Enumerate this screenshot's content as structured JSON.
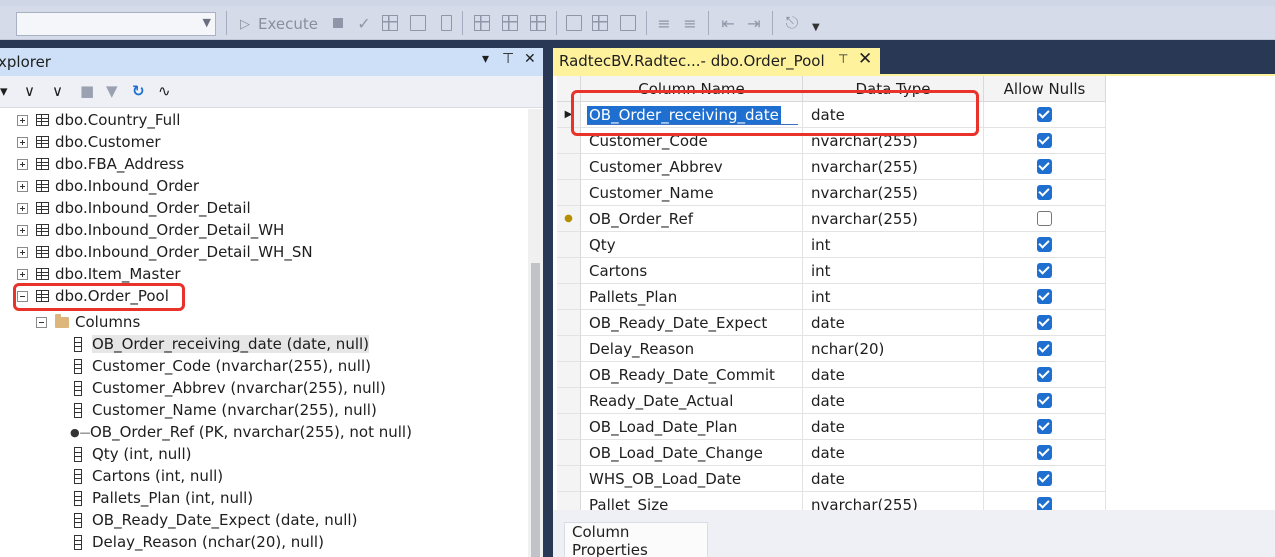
{
  "toolbar": {
    "execute_label": "Execute",
    "database_value": ""
  },
  "object_explorer": {
    "title": "xplorer",
    "tree": [
      {
        "label": "dbo.Country_Full",
        "kind": "table",
        "expanded": false
      },
      {
        "label": "dbo.Customer",
        "kind": "table",
        "expanded": false
      },
      {
        "label": "dbo.FBA_Address",
        "kind": "table",
        "expanded": false
      },
      {
        "label": "dbo.Inbound_Order",
        "kind": "table",
        "expanded": false
      },
      {
        "label": "dbo.Inbound_Order_Detail",
        "kind": "table",
        "expanded": false
      },
      {
        "label": "dbo.Inbound_Order_Detail_WH",
        "kind": "table",
        "expanded": false
      },
      {
        "label": "dbo.Inbound_Order_Detail_WH_SN",
        "kind": "table",
        "expanded": false
      },
      {
        "label": "dbo.Item_Master",
        "kind": "table",
        "expanded": false
      },
      {
        "label": "dbo.Order_Pool",
        "kind": "table",
        "expanded": true
      }
    ],
    "folder": "Columns",
    "columns": [
      {
        "label": "OB_Order_receiving_date (date, null)",
        "pk": false,
        "selected": true
      },
      {
        "label": "Customer_Code (nvarchar(255), null)",
        "pk": false
      },
      {
        "label": "Customer_Abbrev (nvarchar(255), null)",
        "pk": false
      },
      {
        "label": "Customer_Name (nvarchar(255), null)",
        "pk": false
      },
      {
        "label": "OB_Order_Ref (PK, nvarchar(255), not null)",
        "pk": true
      },
      {
        "label": "Qty (int, null)",
        "pk": false
      },
      {
        "label": "Cartons (int, null)",
        "pk": false
      },
      {
        "label": "Pallets_Plan (int, null)",
        "pk": false
      },
      {
        "label": "OB_Ready_Date_Expect (date, null)",
        "pk": false
      },
      {
        "label": "Delay_Reason (nchar(20), null)",
        "pk": false
      }
    ]
  },
  "designer": {
    "tab_title": "RadtecBV.Radtec...- dbo.Order_Pool",
    "headers": {
      "name": "Column Name",
      "type": "Data Type",
      "nulls": "Allow Nulls"
    },
    "rows": [
      {
        "name": "OB_Order_receiving_date",
        "type": "date",
        "nulls": true,
        "editing": true
      },
      {
        "name": "Customer_Code",
        "type": "nvarchar(255)",
        "nulls": true
      },
      {
        "name": "Customer_Abbrev",
        "type": "nvarchar(255)",
        "nulls": true
      },
      {
        "name": "Customer_Name",
        "type": "nvarchar(255)",
        "nulls": true
      },
      {
        "name": "OB_Order_Ref",
        "type": "nvarchar(255)",
        "nulls": false,
        "pk": true
      },
      {
        "name": "Qty",
        "type": "int",
        "nulls": true
      },
      {
        "name": "Cartons",
        "type": "int",
        "nulls": true
      },
      {
        "name": "Pallets_Plan",
        "type": "int",
        "nulls": true
      },
      {
        "name": "OB_Ready_Date_Expect",
        "type": "date",
        "nulls": true
      },
      {
        "name": "Delay_Reason",
        "type": "nchar(20)",
        "nulls": true
      },
      {
        "name": "OB_Ready_Date_Commit",
        "type": "date",
        "nulls": true
      },
      {
        "name": "Ready_Date_Actual",
        "type": "date",
        "nulls": true
      },
      {
        "name": "OB_Load_Date_Plan",
        "type": "date",
        "nulls": true
      },
      {
        "name": "OB_Load_Date_Change",
        "type": "date",
        "nulls": true
      },
      {
        "name": "WHS_OB_Load_Date",
        "type": "date",
        "nulls": true
      },
      {
        "name": "Pallet_Size",
        "type": "nvarchar(255)",
        "nulls": true
      }
    ],
    "properties_tab": "Column Properties"
  },
  "colors": {
    "accent_blue": "#1e6fd0",
    "highlight_red": "#e8322a",
    "tab_yellow": "#fff29d",
    "frame_dark": "#293955"
  }
}
